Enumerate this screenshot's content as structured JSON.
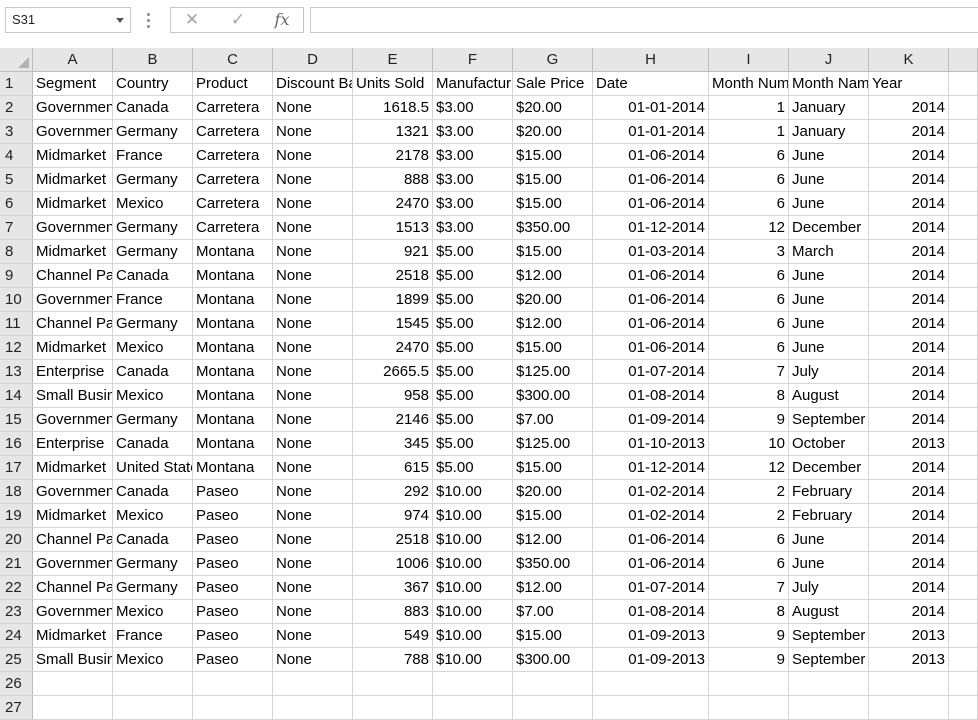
{
  "formula_bar": {
    "name_box": "S31",
    "cancel_icon": "✕",
    "enter_icon": "✓",
    "fx_label": "fx",
    "formula": ""
  },
  "columns": [
    "A",
    "B",
    "C",
    "D",
    "E",
    "F",
    "G",
    "H",
    "I",
    "J",
    "K",
    ""
  ],
  "header_row": [
    "Segment",
    "Country",
    "Product",
    "Discount Band",
    "Units Sold",
    "Manufacturing Price",
    "Sale Price",
    "Date",
    "Month Number",
    "Month Name",
    "Year",
    ""
  ],
  "rows": [
    [
      "Government",
      "Canada",
      "Carretera",
      "None",
      "1618.5",
      "$3.00",
      "$20.00",
      "01-01-2014",
      "1",
      "January",
      "2014",
      ""
    ],
    [
      "Government",
      "Germany",
      "Carretera",
      "None",
      "1321",
      "$3.00",
      "$20.00",
      "01-01-2014",
      "1",
      "January",
      "2014",
      ""
    ],
    [
      "Midmarket",
      "France",
      "Carretera",
      "None",
      "2178",
      "$3.00",
      "$15.00",
      "01-06-2014",
      "6",
      "June",
      "2014",
      ""
    ],
    [
      "Midmarket",
      "Germany",
      "Carretera",
      "None",
      "888",
      "$3.00",
      "$15.00",
      "01-06-2014",
      "6",
      "June",
      "2014",
      ""
    ],
    [
      "Midmarket",
      "Mexico",
      "Carretera",
      "None",
      "2470",
      "$3.00",
      "$15.00",
      "01-06-2014",
      "6",
      "June",
      "2014",
      ""
    ],
    [
      "Government",
      "Germany",
      "Carretera",
      "None",
      "1513",
      "$3.00",
      "$350.00",
      "01-12-2014",
      "12",
      "December",
      "2014",
      ""
    ],
    [
      "Midmarket",
      "Germany",
      "Montana",
      "None",
      "921",
      "$5.00",
      "$15.00",
      "01-03-2014",
      "3",
      "March",
      "2014",
      ""
    ],
    [
      "Channel Partners",
      "Canada",
      "Montana",
      "None",
      "2518",
      "$5.00",
      "$12.00",
      "01-06-2014",
      "6",
      "June",
      "2014",
      ""
    ],
    [
      "Government",
      "France",
      "Montana",
      "None",
      "1899",
      "$5.00",
      "$20.00",
      "01-06-2014",
      "6",
      "June",
      "2014",
      ""
    ],
    [
      "Channel Partners",
      "Germany",
      "Montana",
      "None",
      "1545",
      "$5.00",
      "$12.00",
      "01-06-2014",
      "6",
      "June",
      "2014",
      ""
    ],
    [
      "Midmarket",
      "Mexico",
      "Montana",
      "None",
      "2470",
      "$5.00",
      "$15.00",
      "01-06-2014",
      "6",
      "June",
      "2014",
      ""
    ],
    [
      "Enterprise",
      "Canada",
      "Montana",
      "None",
      "2665.5",
      "$5.00",
      "$125.00",
      "01-07-2014",
      "7",
      "July",
      "2014",
      ""
    ],
    [
      "Small Business",
      "Mexico",
      "Montana",
      "None",
      "958",
      "$5.00",
      "$300.00",
      "01-08-2014",
      "8",
      "August",
      "2014",
      ""
    ],
    [
      "Government",
      "Germany",
      "Montana",
      "None",
      "2146",
      "$5.00",
      "$7.00",
      "01-09-2014",
      "9",
      "September",
      "2014",
      ""
    ],
    [
      "Enterprise",
      "Canada",
      "Montana",
      "None",
      "345",
      "$5.00",
      "$125.00",
      "01-10-2013",
      "10",
      "October",
      "2013",
      ""
    ],
    [
      "Midmarket",
      "United States of America",
      "Montana",
      "None",
      "615",
      "$5.00",
      "$15.00",
      "01-12-2014",
      "12",
      "December",
      "2014",
      ""
    ],
    [
      "Government",
      "Canada",
      "Paseo",
      "None",
      "292",
      "$10.00",
      "$20.00",
      "01-02-2014",
      "2",
      "February",
      "2014",
      ""
    ],
    [
      "Midmarket",
      "Mexico",
      "Paseo",
      "None",
      "974",
      "$10.00",
      "$15.00",
      "01-02-2014",
      "2",
      "February",
      "2014",
      ""
    ],
    [
      "Channel Partners",
      "Canada",
      "Paseo",
      "None",
      "2518",
      "$10.00",
      "$12.00",
      "01-06-2014",
      "6",
      "June",
      "2014",
      ""
    ],
    [
      "Government",
      "Germany",
      "Paseo",
      "None",
      "1006",
      "$10.00",
      "$350.00",
      "01-06-2014",
      "6",
      "June",
      "2014",
      ""
    ],
    [
      "Channel Partners",
      "Germany",
      "Paseo",
      "None",
      "367",
      "$10.00",
      "$12.00",
      "01-07-2014",
      "7",
      "July",
      "2014",
      ""
    ],
    [
      "Government",
      "Mexico",
      "Paseo",
      "None",
      "883",
      "$10.00",
      "$7.00",
      "01-08-2014",
      "8",
      "August",
      "2014",
      ""
    ],
    [
      "Midmarket",
      "France",
      "Paseo",
      "None",
      "549",
      "$10.00",
      "$15.00",
      "01-09-2013",
      "9",
      "September",
      "2013",
      ""
    ],
    [
      "Small Business",
      "Mexico",
      "Paseo",
      "None",
      "788",
      "$10.00",
      "$300.00",
      "01-09-2013",
      "9",
      "September",
      "2013",
      ""
    ],
    [
      "",
      "",
      "",
      "",
      "",
      "",
      "",
      "",
      "",
      "",
      "",
      ""
    ],
    [
      "",
      "",
      "",
      "",
      "",
      "",
      "",
      "",
      "",
      "",
      "",
      ""
    ]
  ]
}
